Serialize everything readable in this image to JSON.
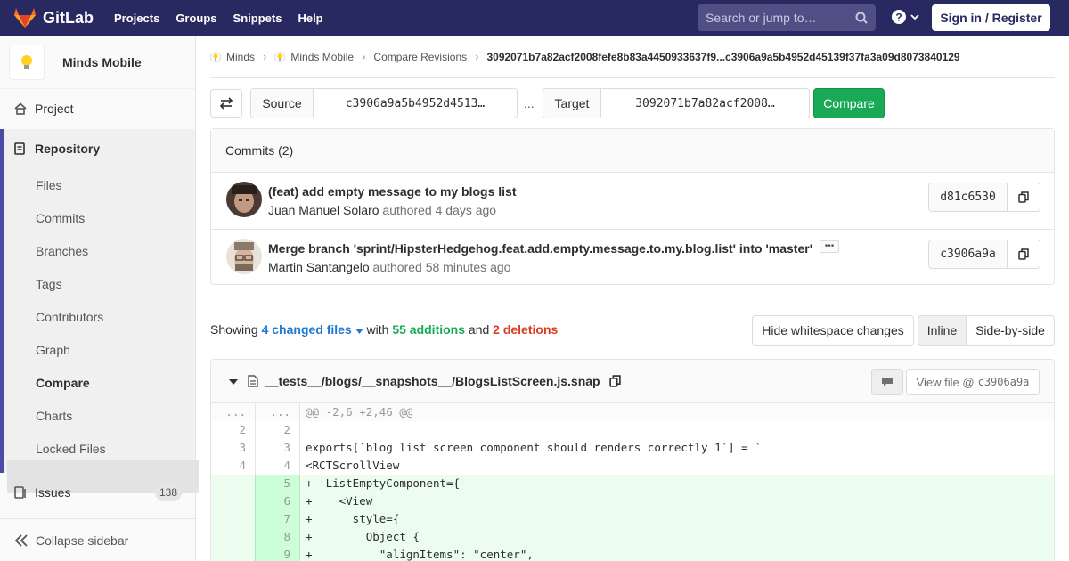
{
  "header": {
    "brand": "GitLab",
    "nav": [
      "Projects",
      "Groups",
      "Snippets",
      "Help"
    ],
    "search_placeholder": "Search or jump to…",
    "signin": "Sign in / Register"
  },
  "sidebar": {
    "project_name": "Minds Mobile",
    "project": "Project",
    "repository": "Repository",
    "repo_items": [
      "Files",
      "Commits",
      "Branches",
      "Tags",
      "Contributors",
      "Graph",
      "Compare",
      "Charts",
      "Locked Files"
    ],
    "issues": "Issues",
    "issues_count": "138",
    "collapse": "Collapse sidebar"
  },
  "breadcrumb": {
    "items": [
      "Minds",
      "Minds Mobile",
      "Compare Revisions"
    ],
    "current": "3092071b7a82acf2008fefe8b83a4450933637f9...c3906a9a5b4952d45139f37fa3a09d8073840129"
  },
  "compare": {
    "source_label": "Source",
    "source_value": "c3906a9a5b4952d4513…",
    "separator": "...",
    "target_label": "Target",
    "target_value": "3092071b7a82acf2008…",
    "button": "Compare"
  },
  "commits": {
    "heading": "Commits (2)",
    "items": [
      {
        "title": "(feat) add empty message to my blogs list",
        "author": "Juan Manuel Solaro",
        "verb": "authored",
        "time": "4 days ago",
        "sha": "d81c6530"
      },
      {
        "title": "Merge branch 'sprint/HipsterHedgehog.feat.add.empty.message.to.my.blog.list' into 'master'",
        "author": "Martin Santangelo",
        "verb": "authored",
        "time": "58 minutes ago",
        "sha": "c3906a9a"
      }
    ]
  },
  "summary": {
    "showing": "Showing",
    "changed": "4 changed files",
    "with": "with",
    "additions": "55 additions",
    "and": "and",
    "deletions": "2 deletions",
    "hide_ws": "Hide whitespace changes",
    "inline": "Inline",
    "side_by_side": "Side-by-side"
  },
  "file": {
    "path": "__tests__/blogs/__snapshots__/BlogsListScreen.js.snap",
    "view_file": "View file @",
    "view_sha": "c3906a9a",
    "lines": [
      {
        "old": "...",
        "new": "...",
        "code": "@@ -2,6 +2,46 @@",
        "type": "hunk"
      },
      {
        "old": "2",
        "new": "2",
        "code": "",
        "type": "ctx"
      },
      {
        "old": "3",
        "new": "3",
        "code": "exports[`blog list screen component should renders correctly 1`] = `",
        "type": "ctx"
      },
      {
        "old": "4",
        "new": "4",
        "code": "<RCTScrollView",
        "type": "ctx"
      },
      {
        "old": "",
        "new": "5",
        "code": "+  ListEmptyComponent={",
        "type": "add"
      },
      {
        "old": "",
        "new": "6",
        "code": "+    <View",
        "type": "add"
      },
      {
        "old": "",
        "new": "7",
        "code": "+      style={",
        "type": "add"
      },
      {
        "old": "",
        "new": "8",
        "code": "+        Object {",
        "type": "add"
      },
      {
        "old": "",
        "new": "9",
        "code": "+          \"alignItems\": \"center\",",
        "type": "add"
      }
    ]
  },
  "colors": {
    "nav_bg": "#292961",
    "accent": "#4b4ba3",
    "green": "#1aaa55",
    "red": "#db3b21",
    "link": "#1f78d1"
  }
}
